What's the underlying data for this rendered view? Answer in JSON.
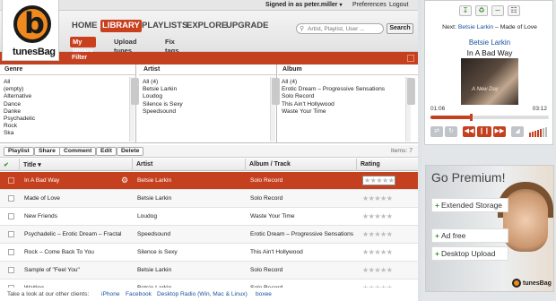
{
  "app": {
    "logo_text": "tunesBag"
  },
  "topbar": {
    "signed_in": "Signed in as peter.miller",
    "caret": "▾",
    "preferences": "Preferences",
    "logout": "Logout"
  },
  "nav": {
    "tabs": [
      "HOME",
      "LIBRARY",
      "PLAYLISTS",
      "EXPLORE",
      "UPGRADE"
    ],
    "active": "LIBRARY"
  },
  "search": {
    "placeholder": "Artist, Playlist, User ...",
    "button": "Search"
  },
  "subnav": {
    "tabs": [
      "My library",
      "Upload tunes",
      "Fix tags"
    ],
    "active": "My library"
  },
  "filterbar": {
    "label": "Filter"
  },
  "browser": {
    "genre": {
      "header": "Genre",
      "items": [
        "All",
        "(empty)",
        "Alternative",
        "Dance",
        "Danke",
        "Psychadelic",
        "Rock",
        "Ska"
      ]
    },
    "artist": {
      "header": "Artist",
      "items": [
        "All (4)",
        "Betsie Larkin",
        "Loudog",
        "Silence is Sexy",
        "Speedsound"
      ]
    },
    "album": {
      "header": "Album",
      "items": [
        "All (4)",
        "Erotic Dream – Progressive Sensations",
        "Solo Record",
        "This Ain't Hollywood",
        "Waste Your Time"
      ]
    }
  },
  "toolbar": {
    "buttons": [
      "Playlist",
      "Share",
      "Comment",
      "Edit",
      "Delete"
    ],
    "items_count": "Items: 7"
  },
  "table": {
    "headers": {
      "check": "✔",
      "title": "Title ▾",
      "artist": "Artist",
      "album": "Album / Track",
      "rating": "Rating"
    },
    "rows": [
      {
        "title": "In A Bad Way",
        "artist": "Betsie Larkin",
        "album": "Solo Record",
        "rating": "★★★★★",
        "selected": true
      },
      {
        "title": "Made of Love",
        "artist": "Betsie Larkin",
        "album": "Solo Record",
        "rating": "★★★★★"
      },
      {
        "title": "New Friends",
        "artist": "Loudog",
        "album": "Waste Your Time",
        "rating": "★★★★★"
      },
      {
        "title": "Psychadelic – Erotic Dream – Fractal",
        "artist": "Speedsound",
        "album": "Erotic Dream – Progressive Sensations",
        "rating": "★★★★★"
      },
      {
        "title": "Rock – Come Back To You",
        "artist": "Silence is Sexy",
        "album": "This Ain't Hollywood",
        "rating": "★★★★★"
      },
      {
        "title": "Sample of \"Feel You\"",
        "artist": "Betsie Larkin",
        "album": "Solo Record",
        "rating": "★★★★★"
      },
      {
        "title": "Waiting",
        "artist": "Betsie Larkin",
        "album": "Solo Record",
        "rating": "★★★★★"
      }
    ]
  },
  "footer": {
    "prefix": "Take a look at our other clients:",
    "links": [
      "iPhone",
      "Facebook",
      "Desktop Radio (Win, Mac & Linux)",
      "boxee"
    ]
  },
  "player": {
    "next_label": "Next:",
    "next_artist": "Betsie Larkin",
    "next_sep": "– Made of Love",
    "artist": "Betsie Larkin",
    "song": "In A Bad Way",
    "cover_text": "A New Day",
    "elapsed": "01:06",
    "total": "03:12",
    "progress": 0.34
  },
  "premium": {
    "title": "Go Premium!",
    "items": [
      "Extended Storage",
      "Ad free",
      "Desktop Upload"
    ],
    "logo": "tunesBag"
  },
  "colors": {
    "accent": "#c4401e",
    "link": "#1a52a0",
    "logo_orange": "#f08a1e"
  }
}
